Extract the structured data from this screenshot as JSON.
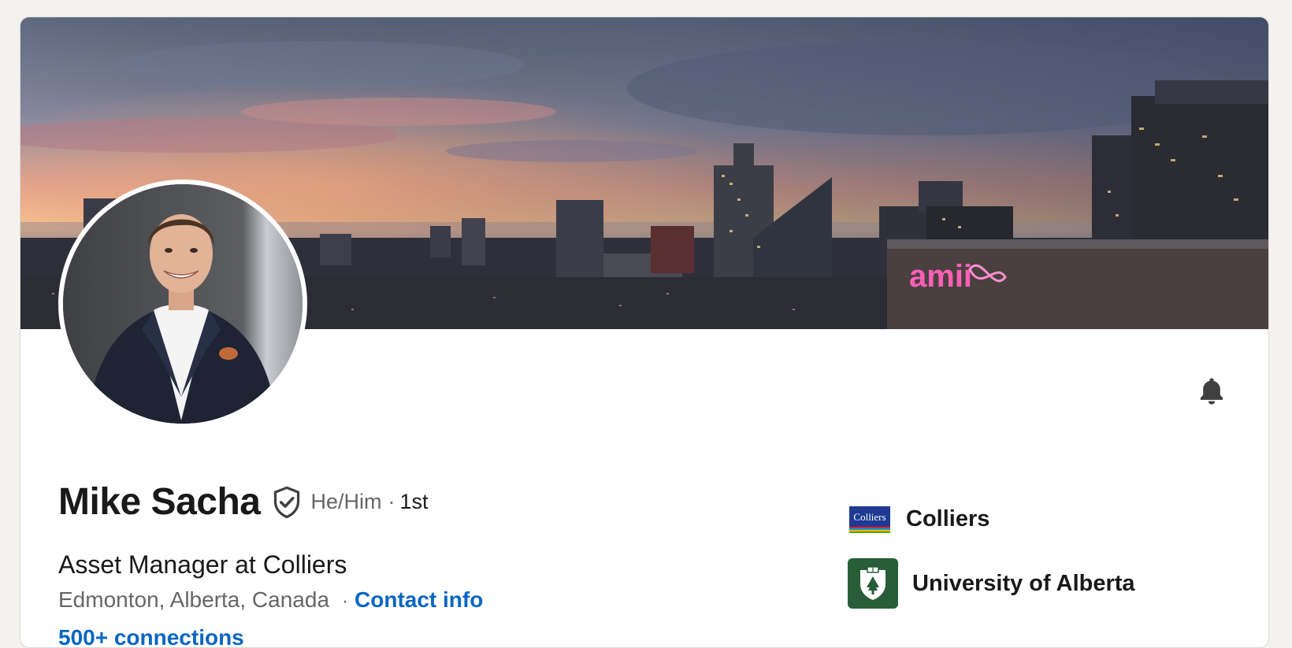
{
  "profile": {
    "name": "Mike Sacha",
    "pronouns": "He/Him",
    "separator": "·",
    "degree": "1st",
    "headline": "Asset Manager at Colliers",
    "location": "Edmonton, Alberta, Canada",
    "location_separator": "·",
    "contact_label": "Contact info",
    "connections_label": "500+ connections"
  },
  "organizations": [
    {
      "name": "Colliers",
      "logo_text": "Colliers",
      "logo_color": "#1f3a93"
    },
    {
      "name": "University of Alberta",
      "logo_color": "#275d38"
    }
  ],
  "banner": {
    "sign_text": "amii",
    "sign_color": "#ff5fb6"
  },
  "icons": {
    "verified": "shield-check-icon",
    "notifications": "bell-icon"
  },
  "colors": {
    "link": "#0a66c2",
    "text_primary": "#191919",
    "text_secondary": "#666666"
  }
}
